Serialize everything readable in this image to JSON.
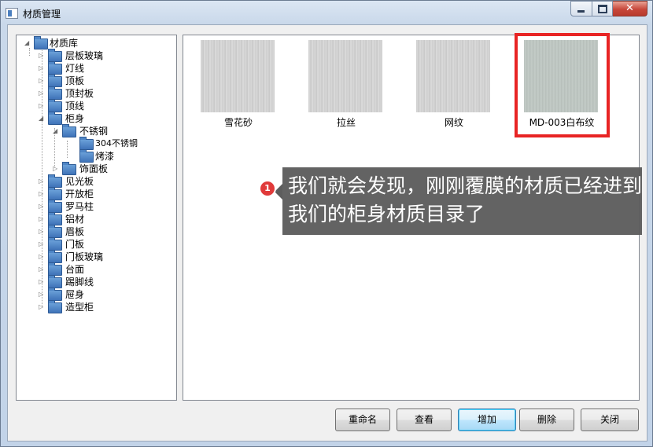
{
  "window": {
    "title": "材质管理"
  },
  "tree": {
    "root": "材质库",
    "items": [
      {
        "label": "层板玻璃"
      },
      {
        "label": "灯线"
      },
      {
        "label": "顶板"
      },
      {
        "label": "顶封板"
      },
      {
        "label": "顶线"
      },
      {
        "label": "柜身"
      },
      {
        "label": "不锈钢"
      },
      {
        "label": "304不锈钢"
      },
      {
        "label": "烤漆"
      },
      {
        "label": "饰面板"
      },
      {
        "label": "见光板"
      },
      {
        "label": "开放柜"
      },
      {
        "label": "罗马柱"
      },
      {
        "label": "铝材"
      },
      {
        "label": "眉板"
      },
      {
        "label": "门板"
      },
      {
        "label": "门板玻璃"
      },
      {
        "label": "台面"
      },
      {
        "label": "踢脚线"
      },
      {
        "label": "屉身"
      },
      {
        "label": "造型柜"
      }
    ]
  },
  "materials": [
    {
      "label": "雪花砂"
    },
    {
      "label": "拉丝"
    },
    {
      "label": "网纹"
    },
    {
      "label": "MD-003白布纹"
    }
  ],
  "callout": {
    "badge": "1",
    "text": "我们就会发现，刚刚覆膜的材质已经进到我们的柜身材质目录了"
  },
  "buttons": {
    "rename": "重命名",
    "view": "查看",
    "add": "增加",
    "delete": "删除",
    "close": "关闭"
  },
  "colors": {
    "highlight": "#e82424",
    "callout_bg": "#5d5d5d",
    "badge": "#e03a3a"
  }
}
